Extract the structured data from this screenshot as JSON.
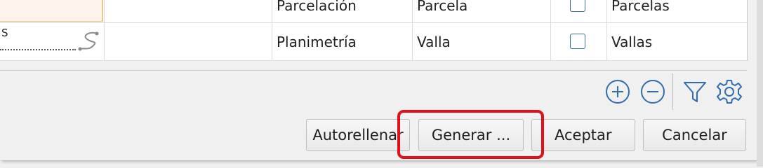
{
  "table": {
    "rows": [
      {
        "category": "Parcelación",
        "element": "Parcela",
        "checked": false,
        "layer": "Parcelas"
      },
      {
        "category": "Planimetría",
        "element": "Valla",
        "checked": false,
        "layer": "Vallas"
      }
    ],
    "row2_preview_label": "S"
  },
  "toolbar": {
    "add_icon": "plus-circle-icon",
    "remove_icon": "minus-circle-icon",
    "filter_icon": "filter-icon",
    "settings_icon": "gear-icon"
  },
  "buttons": {
    "autofill": "Autorellenar",
    "generate": "Generar ...",
    "accept": "Aceptar",
    "cancel": "Cancelar"
  },
  "colors": {
    "highlight": "#e0101a",
    "icon_blue": "#2f6db3"
  }
}
